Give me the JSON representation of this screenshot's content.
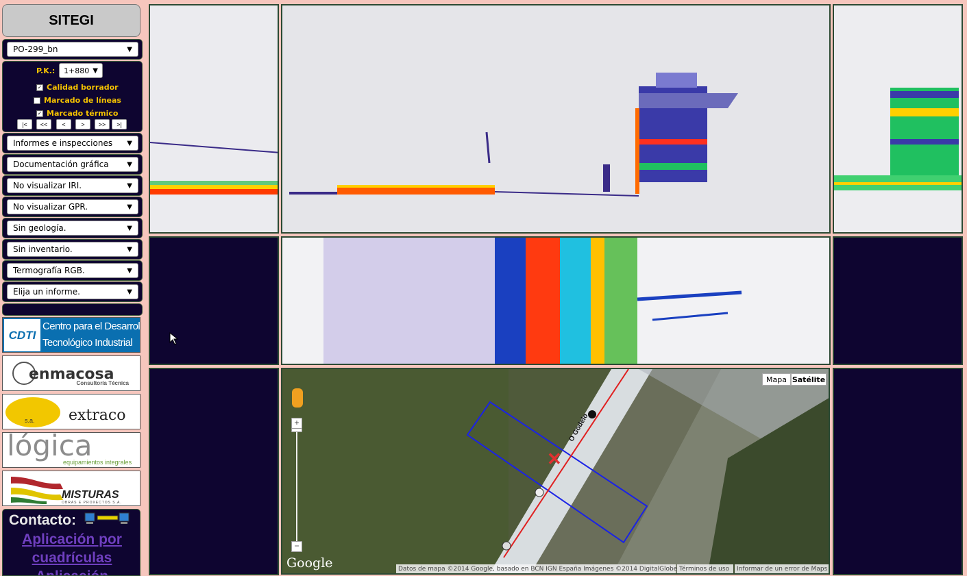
{
  "app_title": "SITEGI",
  "road_select": "PO-299_bn",
  "pk": {
    "label": "P.K.:",
    "value": "1+880"
  },
  "checkboxes": [
    {
      "label": "Calidad borrador",
      "checked": true
    },
    {
      "label": "Marcado de líneas",
      "checked": false
    },
    {
      "label": "Marcado térmico",
      "checked": true
    }
  ],
  "nav_buttons": [
    "|<",
    "<<",
    "<",
    ">",
    ">>",
    ">|"
  ],
  "dropdowns": [
    "Informes e inspecciones",
    "Documentación gráfica",
    "No visualizar IRI.",
    "No visualizar GPR.",
    "Sin geología.",
    "Sin inventario.",
    "Termografía RGB.",
    "Elija un informe."
  ],
  "logos": {
    "cdti_line1": "Centro para el Desarrollo",
    "cdti_line2": "Tecnológico Industrial",
    "cdti_mark": "CDTI",
    "enmacosa": "enmacosa",
    "enmacosa_sub": "Consultoría Técnica",
    "extraco": "extraco",
    "extraco_sa": "s.a.",
    "logica": "lógica",
    "logica_sub": "equipamientos integrales",
    "misturas": "MISTURAS",
    "misturas_sub": "OBRAS E PROXECTOS S.A."
  },
  "contact": {
    "title": "Contacto:",
    "link1_line1": "Aplicación por",
    "link1_line2": "cuadrículas",
    "link2_line1": "Aplicación"
  },
  "map": {
    "type_map": "Mapa",
    "type_satellite": "Satélite",
    "google": "Google",
    "attribution": "Datos de mapa ©2014 Google, basado en BCN IGN España Imágenes ©2014 DigitalGlobe",
    "terms": "Términos de uso",
    "report": "Informar de un error de Maps",
    "road_label": "O Godelo"
  },
  "colors": {
    "accent_yellow": "#f5c200",
    "panel_dark": "#0e0530",
    "page_bg": "#f6c6bd",
    "link_purple": "#6f3fbf"
  }
}
